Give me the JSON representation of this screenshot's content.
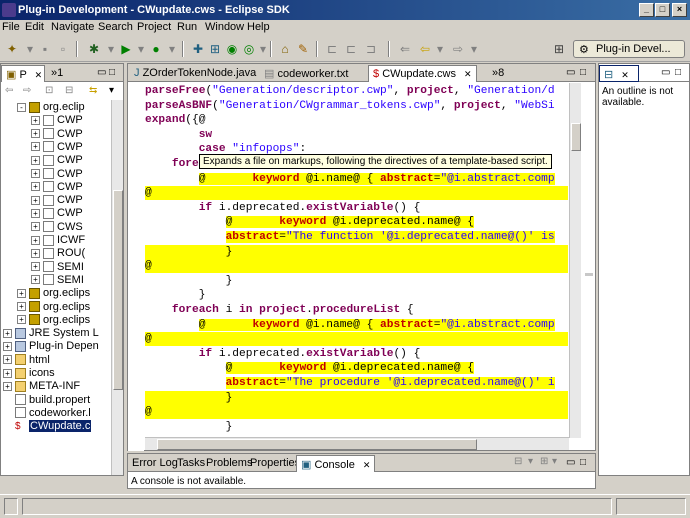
{
  "window": {
    "title": "Plug-in Development - CWupdate.cws - Eclipse SDK"
  },
  "menu": [
    "File",
    "Edit",
    "Navigate",
    "Search",
    "Project",
    "Run",
    "Window",
    "Help"
  ],
  "perspective": {
    "label": "Plug-in Devel..."
  },
  "package_explorer": {
    "tabs": [
      {
        "label": "P"
      },
      {
        "label": "1"
      }
    ],
    "tree": [
      {
        "label": "org.eclip",
        "type": "pkg",
        "indent": 1,
        "expander": "-"
      },
      {
        "label": "CWP",
        "type": "file",
        "indent": 2,
        "expander": "+"
      },
      {
        "label": "CWP",
        "type": "file",
        "indent": 2,
        "expander": "+"
      },
      {
        "label": "CWP",
        "type": "file",
        "indent": 2,
        "expander": "+"
      },
      {
        "label": "CWP",
        "type": "file",
        "indent": 2,
        "expander": "+"
      },
      {
        "label": "CWP",
        "type": "file",
        "indent": 2,
        "expander": "+"
      },
      {
        "label": "CWP",
        "type": "file",
        "indent": 2,
        "expander": "+"
      },
      {
        "label": "CWP",
        "type": "file",
        "indent": 2,
        "expander": "+"
      },
      {
        "label": "CWP",
        "type": "file",
        "indent": 2,
        "expander": "+"
      },
      {
        "label": "CWS",
        "type": "file",
        "indent": 2,
        "expander": "+"
      },
      {
        "label": "ICWF",
        "type": "file",
        "indent": 2,
        "expander": "+"
      },
      {
        "label": "ROU(",
        "type": "file",
        "indent": 2,
        "expander": "+"
      },
      {
        "label": "SEMI",
        "type": "file",
        "indent": 2,
        "expander": "+"
      },
      {
        "label": "SEMI",
        "type": "file",
        "indent": 2,
        "expander": "+"
      },
      {
        "label": "org.eclips",
        "type": "pkg",
        "indent": 1,
        "expander": "+"
      },
      {
        "label": "org.eclips",
        "type": "pkg",
        "indent": 1,
        "expander": "+"
      },
      {
        "label": "org.eclips",
        "type": "pkg",
        "indent": 1,
        "expander": "+"
      },
      {
        "label": "JRE System L",
        "type": "jar",
        "indent": 0,
        "expander": "+"
      },
      {
        "label": "Plug-in Depen",
        "type": "jar",
        "indent": 0,
        "expander": "+"
      },
      {
        "label": "html",
        "type": "folder",
        "indent": 0,
        "expander": "+"
      },
      {
        "label": "icons",
        "type": "folder",
        "indent": 0,
        "expander": "+"
      },
      {
        "label": "META-INF",
        "type": "folder",
        "indent": 0,
        "expander": "+"
      },
      {
        "label": "build.propert",
        "type": "file",
        "indent": 0,
        "expander": ""
      },
      {
        "label": "codeworker.l",
        "type": "file",
        "indent": 0,
        "expander": ""
      },
      {
        "label": "CWupdate.c",
        "type": "cws",
        "indent": 0,
        "expander": "",
        "selected": true
      }
    ]
  },
  "editor": {
    "tabs": [
      {
        "label": "ZOrderTokenNode.java",
        "active": false
      },
      {
        "label": "codeworker.txt",
        "active": false
      },
      {
        "label": "CWupdate.cws",
        "active": true
      },
      {
        "label": "8",
        "active": false
      }
    ],
    "tooltip": "Expands a file on markups, following the directives of a template-based script.",
    "lines": [
      "parseFree(\"Generation/descriptor.cwp\", project, \"Generation/d",
      "parseAsBNF(\"Generation/CWgrammar_tokens.cwp\", project, \"WebSi",
      "expand({@",
      "        sw",
      "        case \"infopops\":",
      "    foreach i in project.functionList {",
      "        @       keyword @i.name@ { abstract=\"@i.abstract.comp",
      "@",
      "        if i.deprecated.existVariable() {",
      "            @       keyword @i.deprecated.name@ {",
      "            abstract=\"The function '@i.deprecated.name@()' is",
      "            }",
      "@",
      "            }",
      "        }",
      "    foreach i in project.procedureList {",
      "        @       keyword @i.name@ { abstract=\"@i.abstract.comp",
      "@",
      "        if i.deprecated.existVariable() {",
      "            @       keyword @i.deprecated.name@ {",
      "            abstract=\"The procedure '@i.deprecated.name@()' i",
      "            }",
      "@",
      "            }"
    ]
  },
  "outline": {
    "tab_label": "",
    "message": "An outline is not available."
  },
  "bottom_panel": {
    "tabs": [
      {
        "label": "Error Log",
        "active": false
      },
      {
        "label": "Tasks",
        "active": false
      },
      {
        "label": "Problems",
        "active": false
      },
      {
        "label": "Properties",
        "active": false
      },
      {
        "label": "Console",
        "active": true
      }
    ],
    "message": "A console is not available."
  },
  "colors": {
    "highlight": "#ffff00",
    "keyword": "#7f0055",
    "string": "#2a00ff",
    "titlebar": "#0a246a"
  }
}
